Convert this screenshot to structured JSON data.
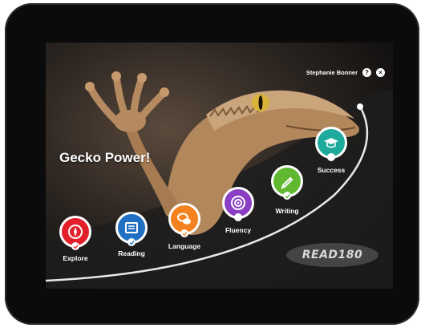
{
  "header": {
    "user_name": "Stephanie Bonner",
    "help_icon": "question-circle-icon",
    "close_icon": "close-circle-icon"
  },
  "hero": {
    "title": "Gecko Power!"
  },
  "brand": {
    "logo_text": "READ180"
  },
  "nav": [
    {
      "label": "Explore",
      "color": "#e21f2b",
      "icon": "compass-icon"
    },
    {
      "label": "Reading",
      "color": "#1f6fc2",
      "icon": "book-icon"
    },
    {
      "label": "Language",
      "color": "#f58220",
      "icon": "speech-bubbles-icon"
    },
    {
      "label": "Fluency",
      "color": "#8a3fc4",
      "icon": "target-icon"
    },
    {
      "label": "Writing",
      "color": "#5fb830",
      "icon": "pencil-icon"
    },
    {
      "label": "Success",
      "color": "#1eaa9c",
      "icon": "graduation-cap-icon"
    }
  ]
}
